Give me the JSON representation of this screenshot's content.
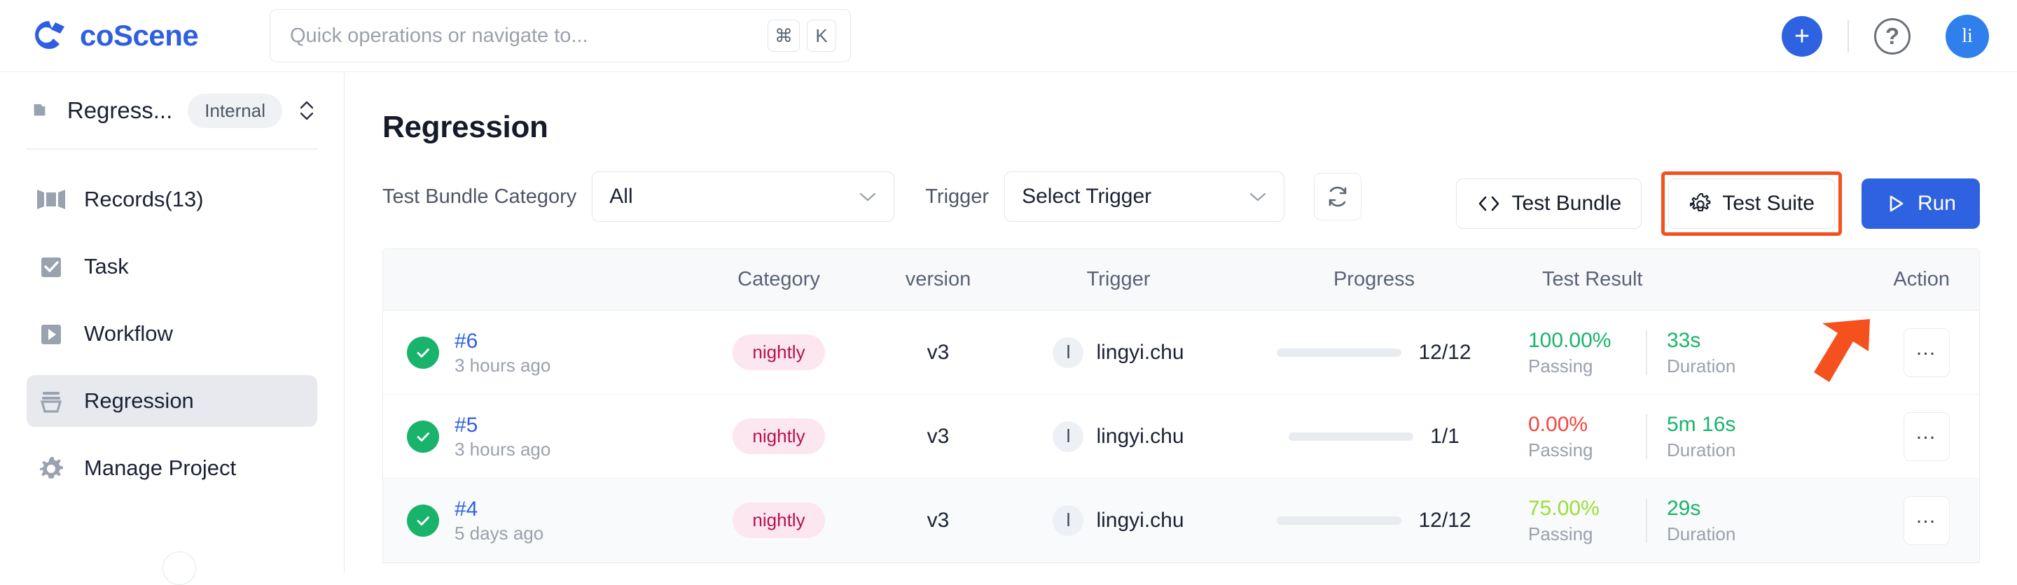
{
  "header": {
    "brand_name": "coScene",
    "brand_color": "#2f5fe0",
    "search": {
      "placeholder": "Quick operations or navigate to...",
      "kbd_modifier": "⌘",
      "kbd_key": "K"
    },
    "add_label": "+",
    "help_label": "?",
    "avatar_initials": "li",
    "avatar_color": "#2f80ed"
  },
  "sidebar": {
    "project": {
      "name": "Regress...",
      "visibility_chip": "Internal"
    },
    "items": [
      {
        "label": "Records(13)",
        "icon": "records-icon",
        "active": false
      },
      {
        "label": "Task",
        "icon": "task-check-icon",
        "active": false
      },
      {
        "label": "Workflow",
        "icon": "workflow-play-icon",
        "active": false
      },
      {
        "label": "Regression",
        "icon": "regression-stack-icon",
        "active": true
      },
      {
        "label": "Manage Project",
        "icon": "gear-icon",
        "active": false
      }
    ]
  },
  "main": {
    "page_title": "Regression",
    "toolbar": {
      "category_label": "Test Bundle Category",
      "category_value": "All",
      "trigger_label": "Trigger",
      "trigger_value": "Select Trigger",
      "refresh_icon": "refresh-icon",
      "test_bundle_label": "Test Bundle",
      "test_suite_label": "Test Suite",
      "run_label": "Run",
      "highlight_color": "#f4511e",
      "highlighted_button": "Test Suite"
    },
    "table": {
      "columns": [
        "",
        "Category",
        "version",
        "Trigger",
        "Progress",
        "Test Result",
        "Action"
      ],
      "rows": [
        {
          "status": "success",
          "id": "#6",
          "time": "3 hours ago",
          "category": "nightly",
          "version": "v3",
          "trigger_avatar": "l",
          "trigger_user": "lingyi.chu",
          "progress_text": "12/12",
          "progress_pct": 100,
          "pass_pct": "100.00%",
          "pass_label": "Passing",
          "pass_color": "#19b36b",
          "duration": "33s",
          "duration_label": "Duration",
          "action": "…",
          "hover": false
        },
        {
          "status": "success",
          "id": "#5",
          "time": "3 hours ago",
          "category": "nightly",
          "version": "v3",
          "trigger_avatar": "l",
          "trigger_user": "lingyi.chu",
          "progress_text": "1/1",
          "progress_pct": 100,
          "pass_pct": "0.00%",
          "pass_label": "Passing",
          "pass_color": "#f4453c",
          "duration": "5m 16s",
          "duration_label": "Duration",
          "action": "…",
          "hover": false
        },
        {
          "status": "success",
          "id": "#4",
          "time": "5 days ago",
          "category": "nightly",
          "version": "v3",
          "trigger_avatar": "l",
          "trigger_user": "lingyi.chu",
          "progress_text": "12/12",
          "progress_pct": 100,
          "pass_pct": "75.00%",
          "pass_label": "Passing",
          "pass_color": "#9ade3b",
          "duration": "29s",
          "duration_label": "Duration",
          "action": "…",
          "hover": true
        }
      ]
    }
  }
}
